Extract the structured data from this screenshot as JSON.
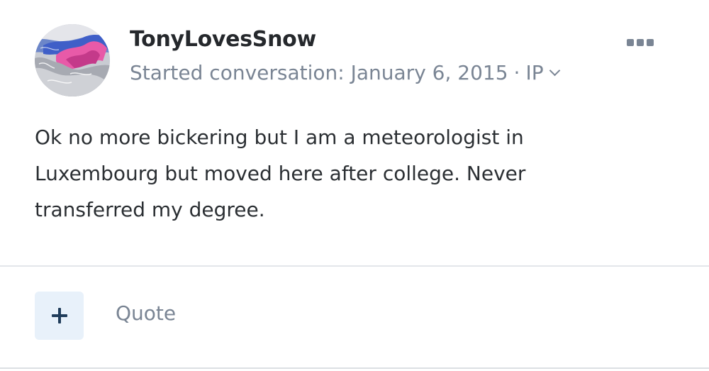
{
  "post": {
    "author": "TonyLovesSnow",
    "meta_prefix": "Started conversation:",
    "date": "January 6, 2015",
    "separator": "·",
    "ip_label": "IP",
    "body": "Ok no more bickering but I am a meteorologist in Luxembourg but moved here after college. Never transferred my degree."
  },
  "actions": {
    "quote_label": "Quote"
  },
  "icons": {
    "avatar": "weather-map-avatar",
    "more": "more-options-icon",
    "chevron": "chevron-down-icon",
    "plus": "plus-icon"
  },
  "colors": {
    "author": "#25282c",
    "meta": "#7a8594",
    "body_text": "#2b2f33",
    "plus_button_bg": "#e8f1fa",
    "plus_icon": "#1f3c5a"
  }
}
